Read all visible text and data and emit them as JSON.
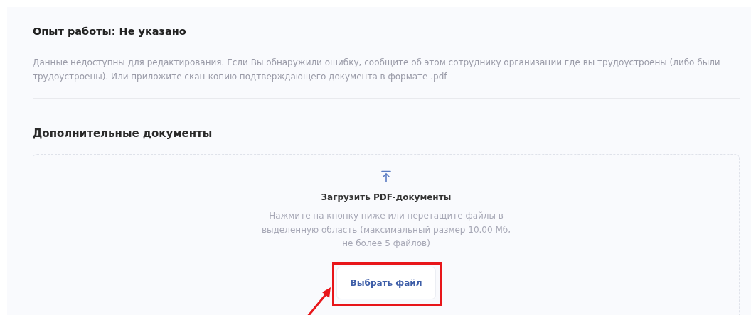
{
  "experience": {
    "title": "Опыт работы: Не указано",
    "note": "Данные недоступны для редактирования. Если Вы обнаружили ошибку, сообщите об этом сотруднику организации где вы трудоустроены (либо были трудоустроены). Или приложите скан-копию подтверждающего документа в формате .pdf"
  },
  "documents": {
    "title": "Дополнительные документы",
    "upload": {
      "title": "Загрузить PDF-документы",
      "hint": "Нажмите на кнопку ниже или перетащите файлы в выделенную область (максимальный размер 10.00 Мб, не более 5 файлов)",
      "button": "Выбрать файл"
    }
  }
}
